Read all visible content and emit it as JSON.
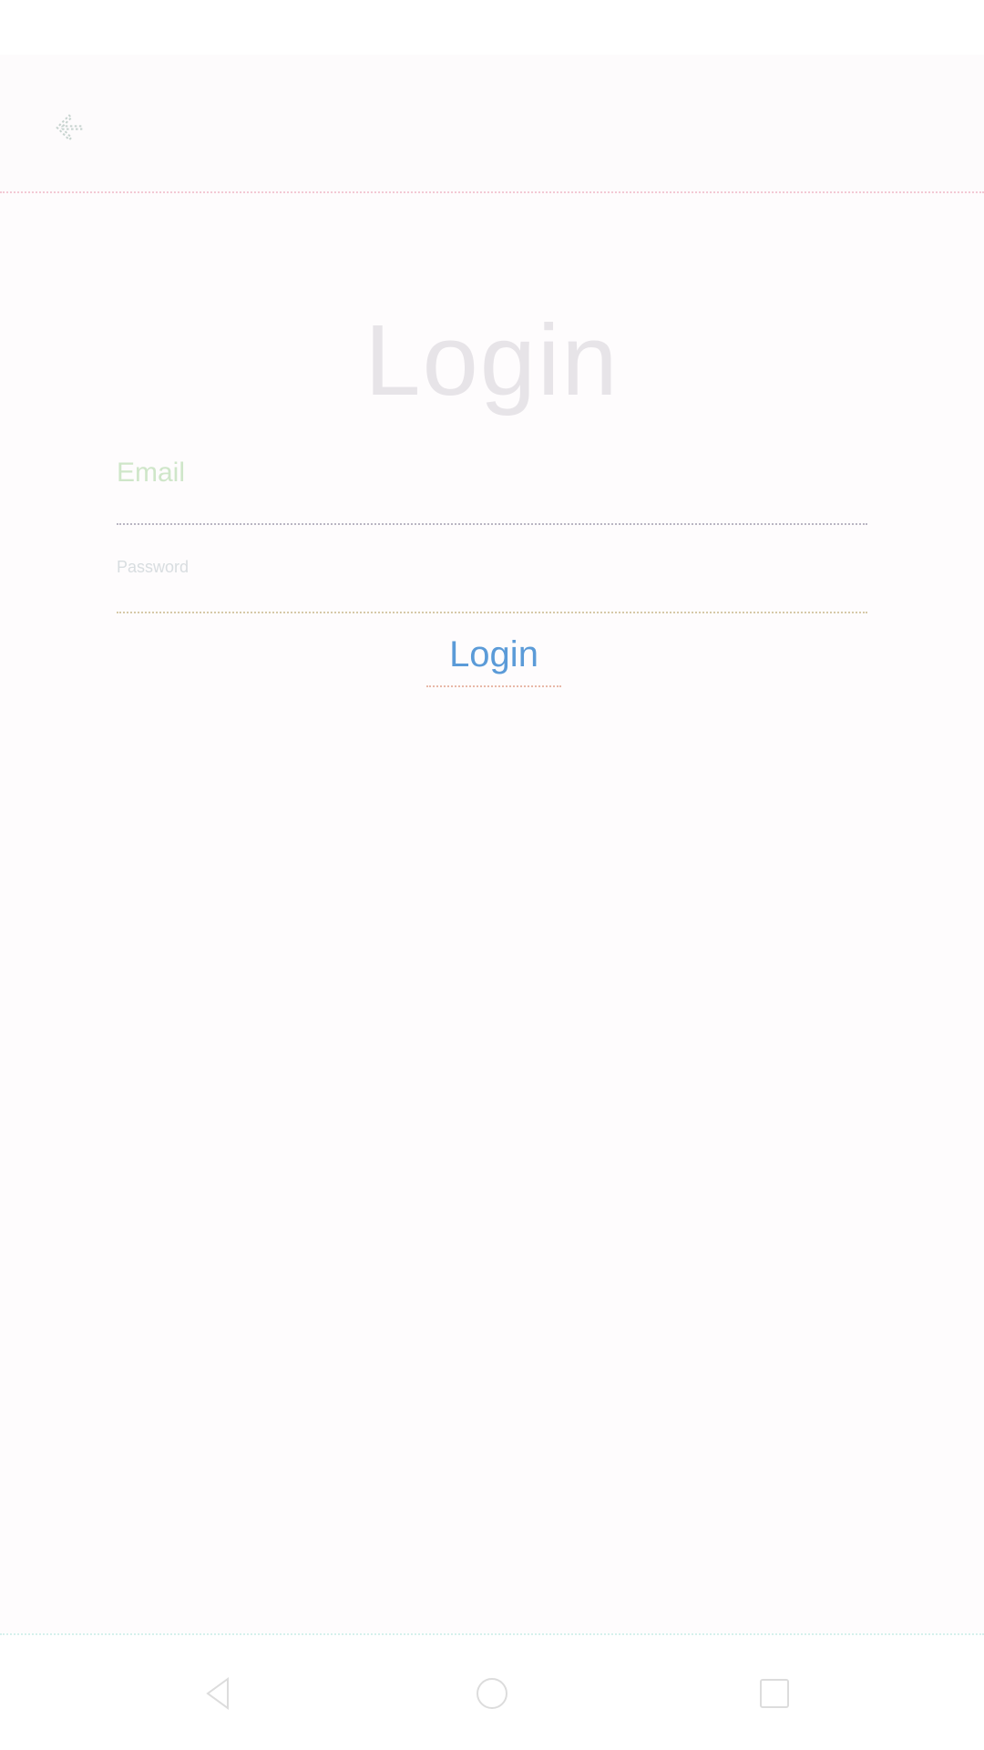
{
  "app_bar": {
    "back_icon": "arrow-back-icon"
  },
  "login_form": {
    "title": "Login",
    "username_label": "Email",
    "username_value": "",
    "password_label": "Password",
    "password_value": "",
    "submit_label": "Login"
  },
  "nav_bar": {
    "back_icon": "triangle-back-icon",
    "home_icon": "circle-home-icon",
    "recents_icon": "square-recents-icon"
  },
  "colors": {
    "accent": "#5b9bd8",
    "title": "#e7e4e8",
    "label": "#cfe6c9"
  }
}
